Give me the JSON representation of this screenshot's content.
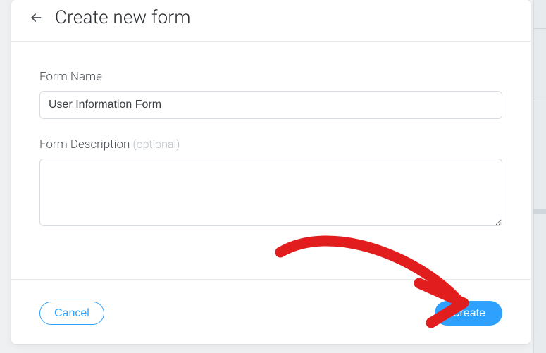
{
  "header": {
    "title": "Create new form"
  },
  "form": {
    "name_label": "Form Name",
    "name_value": "User Information Form",
    "description_label": "Form Description",
    "description_optional": "(optional)",
    "description_value": ""
  },
  "footer": {
    "cancel_label": "Cancel",
    "create_label": "Create"
  },
  "colors": {
    "primary": "#2ea1ff",
    "annotation": "#e11d1d"
  }
}
